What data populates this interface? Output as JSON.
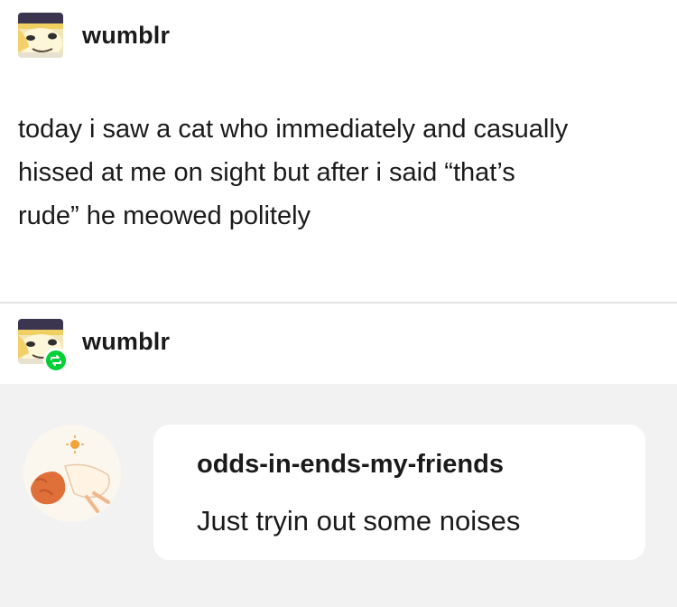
{
  "original_post": {
    "username": "wumblr",
    "avatar_icon": "character-avatar-icon",
    "body_lines": [
      "today i saw a cat who immediately and casually",
      "hissed at me on sight but after i said “that’s",
      "rude” he meowed politely"
    ]
  },
  "reblog": {
    "username": "wumblr",
    "avatar_icon": "character-avatar-icon",
    "badge_icon": "reblog-icon",
    "badge_color": "#00cf35"
  },
  "quoted_message": {
    "avatar_icon": "sleeping-creature-avatar-icon",
    "username": "odds-in-ends-my-friends",
    "text": "Just tryin out some noises"
  },
  "colors": {
    "background": "#ffffff",
    "reblog_background": "#f2f2f2",
    "divider": "#e2e2e2",
    "text": "#1a1a1a"
  }
}
